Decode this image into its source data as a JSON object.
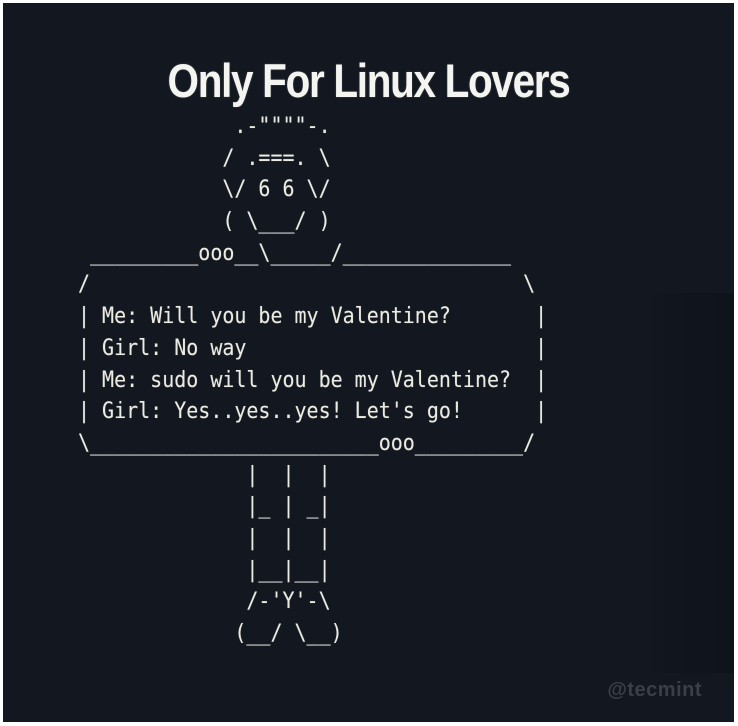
{
  "title": "Only For Linux Lovers",
  "art_lines": [
    "             .-\"\"\"\"-.",
    "            / .===. \\",
    "            \\/ 6 6 \\/",
    "            ( \\___/ )",
    " _________ooo__\\_____/______________",
    "/                                    \\",
    "| Me: Will you be my Valentine?       |",
    "| Girl: No way                        |",
    "| Me: sudo will you be my Valentine?  |",
    "| Girl: Yes..yes..yes! Let's go!      |",
    "\\________________________ooo_________/",
    "              |  |  |",
    "              |_ | _|",
    "              |  |  |",
    "              |__|__|",
    "              /-'Y'-\\",
    "             (__/ \\__)"
  ],
  "watermark": "@tecmint",
  "colors": {
    "background": "#121720",
    "text": "#ecebe2",
    "title": "#f4f4f0"
  }
}
